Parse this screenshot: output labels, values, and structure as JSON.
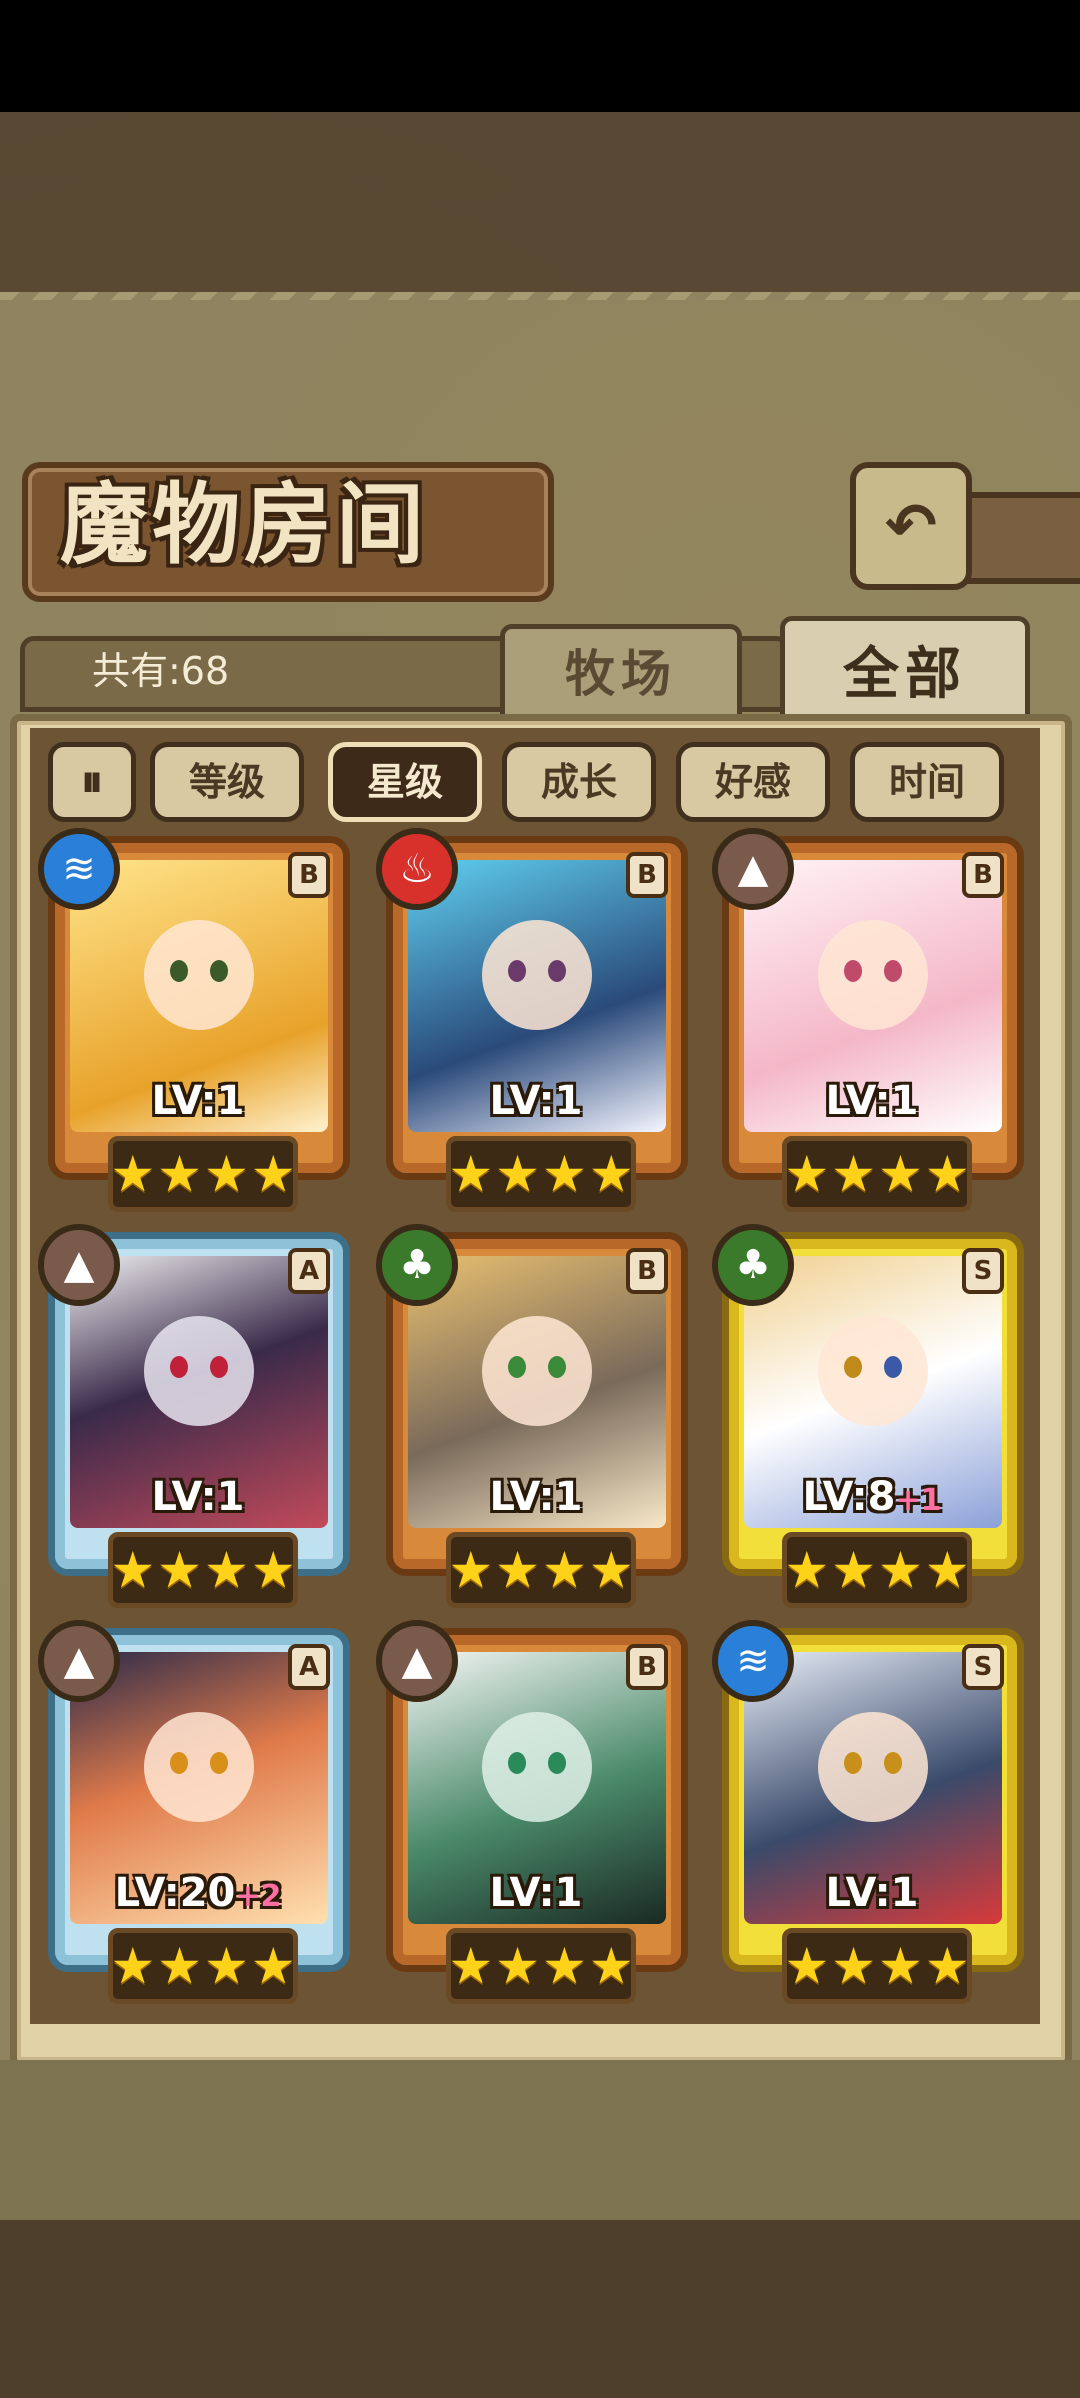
{
  "header": {
    "title": "魔物房间",
    "back_icon": "back-arrow-icon"
  },
  "summary": {
    "count_label": "共有:68"
  },
  "tabs": [
    {
      "label": "牧场",
      "active": false
    },
    {
      "label": "全部",
      "active": true
    }
  ],
  "sort": {
    "toggle_icon": "sort-toggle-icon",
    "buttons": [
      {
        "label": "等级",
        "active": false
      },
      {
        "label": "星级",
        "active": true
      },
      {
        "label": "成长",
        "active": false
      },
      {
        "label": "好感",
        "active": false
      },
      {
        "label": "时间",
        "active": false
      }
    ]
  },
  "monsters": [
    {
      "element": "water",
      "rank": "B",
      "level": "LV:1",
      "plus": "",
      "stars": 4
    },
    {
      "element": "fire",
      "rank": "B",
      "level": "LV:1",
      "plus": "",
      "stars": 4
    },
    {
      "element": "earth",
      "rank": "B",
      "level": "LV:1",
      "plus": "",
      "stars": 4
    },
    {
      "element": "earth",
      "rank": "A",
      "level": "LV:1",
      "plus": "",
      "stars": 4
    },
    {
      "element": "wood",
      "rank": "B",
      "level": "LV:1",
      "plus": "",
      "stars": 4
    },
    {
      "element": "wood",
      "rank": "S",
      "level": "LV:8",
      "plus": "+1",
      "stars": 4
    },
    {
      "element": "earth",
      "rank": "A",
      "level": "LV:20",
      "plus": "+2",
      "stars": 4
    },
    {
      "element": "earth",
      "rank": "B",
      "level": "LV:1",
      "plus": "",
      "stars": 4
    },
    {
      "element": "water",
      "rank": "S",
      "level": "LV:1",
      "plus": "",
      "stars": 4
    }
  ],
  "colors": {
    "frame_B": "#d8893a",
    "frame_A": "#bfe0ee",
    "frame_S": "#f3df3a",
    "star": "#ffd21a",
    "active_sort_bg": "#3e2a18"
  }
}
